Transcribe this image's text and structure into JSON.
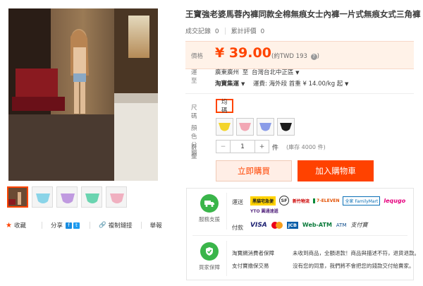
{
  "product": {
    "title": "王寶強老婆馬蓉內褲同款全棉無痕女士內褲一片式無痕女式三角褲",
    "sales_label": "成交記錄",
    "sales_count": "0",
    "reviews_label": "累計評價",
    "reviews_count": "0"
  },
  "price": {
    "label": "價格",
    "value": "¥ 39.00",
    "converted": "(約TWD 193",
    "help": "?",
    "close_paren": ")"
  },
  "shipping": {
    "label": "運至",
    "origin": "廣東廣州",
    "to_word": "至",
    "destination": "台灣台北中正區",
    "method": "淘寶集運",
    "fee_text": "運費: 海外段 首重 ¥ 14.00/kg 起"
  },
  "size": {
    "label": "尺碼",
    "selected": "均碼"
  },
  "color": {
    "label": "顏色分類",
    "swatch_colors": [
      "#f3d42c",
      "#f2a7b4",
      "#8a9ce8",
      "#1a1a1a"
    ]
  },
  "quantity": {
    "label": "數量",
    "minus": "−",
    "value": "1",
    "plus": "+",
    "unit": "件",
    "stock": "(庫存 4000 件)"
  },
  "buttons": {
    "buy_now": "立即購買",
    "add_to_cart": "加入購物車"
  },
  "actions": {
    "favorite": "收藏",
    "share": "分享",
    "copy_link": "複制鏈接",
    "report": "舉報"
  },
  "service": {
    "support_label": "服務支援",
    "shipping_label": "運送",
    "carriers": [
      "黑貓宅急便",
      "SF",
      "新竹物流",
      "7-ELEVEN",
      "全家 FamilyMart",
      "lequgo",
      "YTO 圓通速遞"
    ],
    "payment_label": "付款",
    "payments": [
      "VISA",
      "MC",
      "JCB",
      "Web-ATM",
      "ATM",
      "支付寶"
    ],
    "guarantee_label": "買家保障",
    "guarantee_title": "淘寶網消費者保障",
    "guarantee_line1": "未收到商品，全額退款！商品與描述不符，退貨退款。",
    "guarantee_title2": "支付寶擔保交易",
    "guarantee_line2": "沒有您的同意，我們將不會把您的錢款交付給賣家。"
  },
  "colors": {
    "accent": "#ff4400",
    "price_bg": "#fff2e8",
    "buy_bg": "#ffeee6",
    "cart_bg": "#ff4200",
    "service_green": "#3ab54a"
  }
}
